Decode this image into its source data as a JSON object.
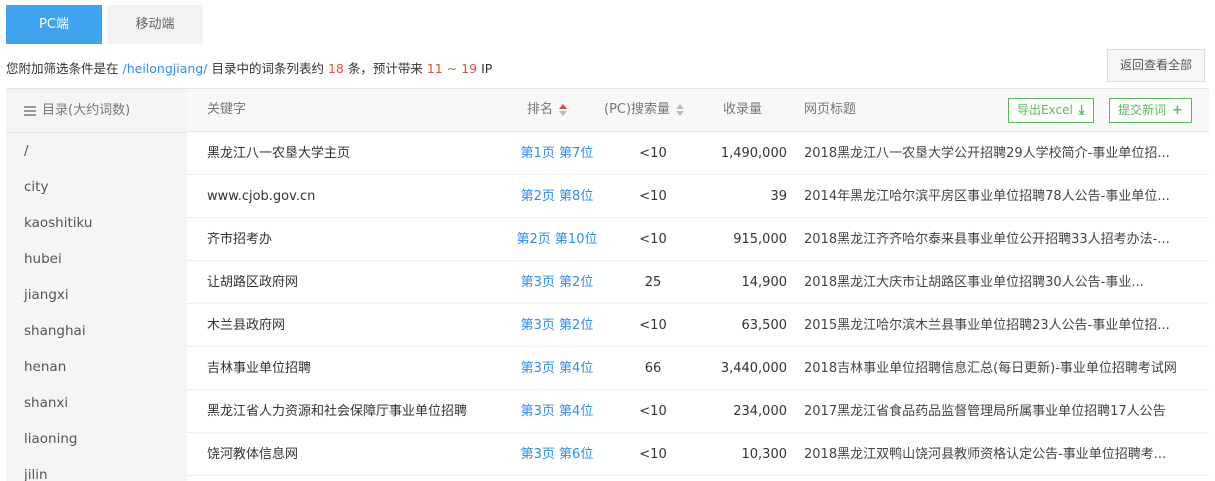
{
  "tabs": [
    {
      "label": "PC端",
      "active": true
    },
    {
      "label": "移动端",
      "active": false
    }
  ],
  "filter": {
    "prefix": "您附加筛选条件是在",
    "path": "/heilongjiang/",
    "middle": "目录中的词条列表约",
    "count": "18",
    "unit": "条，预计带来",
    "ip_low": "11",
    "tilde": "~",
    "ip_high": "19",
    "ip_label": "IP"
  },
  "back_button": "返回查看全部",
  "sidebar": {
    "header": "目录(大约词数)",
    "items": [
      "/",
      "city",
      "kaoshitiku",
      "hubei",
      "jiangxi",
      "shanghai",
      "henan",
      "shanxi",
      "liaoning",
      "jilin"
    ]
  },
  "table": {
    "columns": {
      "keyword": "关键字",
      "rank": "排名",
      "volume": "(PC)搜索量",
      "indexed": "收录量",
      "title": "网页标题"
    },
    "export_button": "导出Excel",
    "submit_button": "提交新词",
    "rows": [
      {
        "keyword": "黑龙江八一农垦大学主页",
        "rank": "第1页 第7位",
        "volume": "<10",
        "indexed": "1,490,000",
        "title": "2018黑龙江八一农垦大学公开招聘29人学校简介-事业单位招..."
      },
      {
        "keyword": "www.cjob.gov.cn",
        "rank": "第2页 第8位",
        "volume": "<10",
        "indexed": "39",
        "title": "2014年黑龙江哈尔滨平房区事业单位招聘78人公告-事业单位..."
      },
      {
        "keyword": "齐市招考办",
        "rank": "第2页 第10位",
        "volume": "<10",
        "indexed": "915,000",
        "title": "2018黑龙江齐齐哈尔泰来县事业单位公开招聘33人招考办法-..."
      },
      {
        "keyword": "让胡路区政府网",
        "rank": "第3页 第2位",
        "volume": "25",
        "indexed": "14,900",
        "title": "2018黑龙江大庆市让胡路区事业单位招聘30人公告-事业..."
      },
      {
        "keyword": "木兰县政府网",
        "rank": "第3页 第2位",
        "volume": "<10",
        "indexed": "63,500",
        "title": "2015黑龙江哈尔滨木兰县事业单位招聘23人公告-事业单位招..."
      },
      {
        "keyword": "吉林事业单位招聘",
        "rank": "第3页 第4位",
        "volume": "66",
        "indexed": "3,440,000",
        "title": "2018吉林事业单位招聘信息汇总(每日更新)-事业单位招聘考试网"
      },
      {
        "keyword": "黑龙江省人力资源和社会保障厅事业单位招聘",
        "rank": "第3页 第4位",
        "volume": "<10",
        "indexed": "234,000",
        "title": "2017黑龙江省食品药品监督管理局所属事业单位招聘17人公告"
      },
      {
        "keyword": "饶河教体信息网",
        "rank": "第3页 第6位",
        "volume": "<10",
        "indexed": "10,300",
        "title": "2018黑龙江双鸭山饶河县教师资格认定公告-事业单位招聘考..."
      }
    ]
  },
  "colors": {
    "accent": "#3fa4ef",
    "link": "#2d8cf0",
    "highlight": "#e94b3c",
    "button_green": "#5cb85c"
  }
}
